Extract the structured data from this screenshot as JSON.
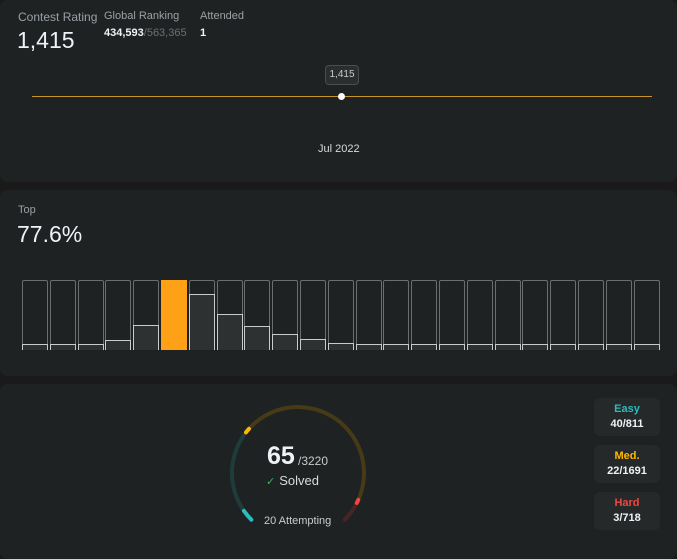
{
  "contest": {
    "rating_label": "Contest Rating",
    "rating_value": "1,415",
    "ranking_label": "Global Ranking",
    "ranking_value": "434,593",
    "ranking_total": "/563,365",
    "attended_label": "Attended",
    "attended_value": "1",
    "tooltip_value": "1,415",
    "date_label": "Jul 2022",
    "line_color": "#c9942a"
  },
  "top": {
    "label": "Top",
    "value": "77.6%",
    "histogram_levels": [
      0.08,
      0.08,
      0.08,
      0.14,
      0.35,
      1.0,
      0.8,
      0.52,
      0.34,
      0.23,
      0.15,
      0.1,
      0.08,
      0.08,
      0.08,
      0.08,
      0.08,
      0.08,
      0.08,
      0.08,
      0.08,
      0.08,
      0.08
    ],
    "active_index": 5,
    "active_color": "#ffa116"
  },
  "solved": {
    "count": "65",
    "total": "/3220",
    "label": "Solved",
    "attempting": "20 Attempting",
    "ring": {
      "easy_fraction": 0.049,
      "medium_fraction": 0.013,
      "hard_fraction": 0.004
    },
    "difficulties": [
      {
        "name": "Easy",
        "value": "40/811",
        "color": "#2cbbbd"
      },
      {
        "name": "Med.",
        "value": "22/1691",
        "color": "#ffb800"
      },
      {
        "name": "Hard",
        "value": "3/718",
        "color": "#ef4743"
      }
    ]
  }
}
